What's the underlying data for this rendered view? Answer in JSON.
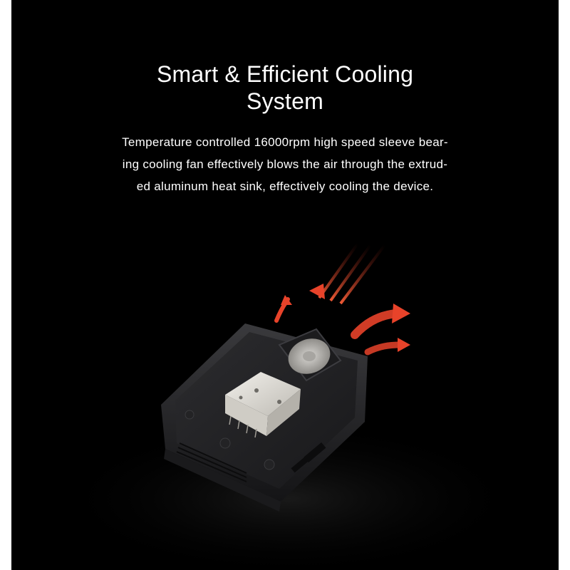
{
  "heading": {
    "line1": "Smart & Efficient Cooling",
    "line2": "System"
  },
  "description": {
    "line1": "Temperature controlled 16000rpm high speed sleeve bear-",
    "line2": "ing cooling fan effectively blows the air through the extrud-",
    "line3": "ed aluminum heat sink, effectively cooling the device."
  },
  "colors": {
    "background": "#000000",
    "text": "#ffffff",
    "heat_arrow": "#e8432a",
    "device_body": "#2a2a2c",
    "heatsink": "#e8e6e1"
  },
  "illustration": {
    "subject": "device-with-cooling-fan-and-heatsink",
    "icons": [
      "heat-airflow-arrows-icon",
      "cooling-fan-icon",
      "heatsink-icon"
    ]
  }
}
